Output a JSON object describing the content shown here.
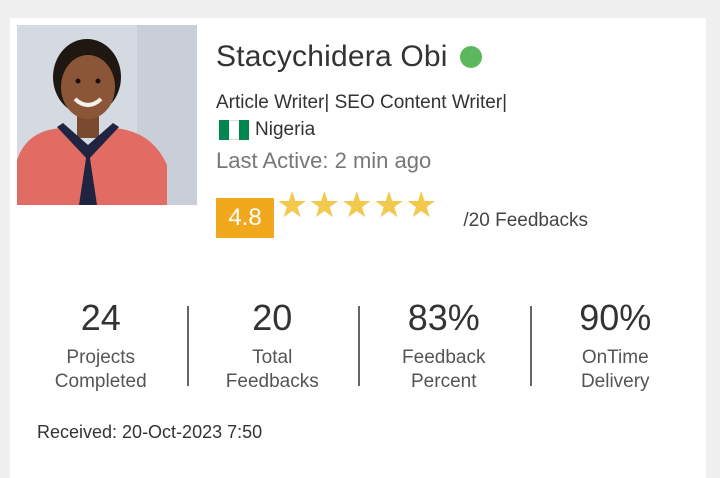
{
  "profile": {
    "name": "Stacychidera Obi",
    "online_status": "online",
    "role": "Article Writer| SEO Content Writer|",
    "country": "Nigeria",
    "country_flag": "nigeria-flag-icon",
    "last_active": "Last Active: 2 min ago",
    "rating": "4.8",
    "stars": 5,
    "feedback_count": "/20 Feedbacks"
  },
  "stats": [
    {
      "value": "24",
      "label_line1": "Projects",
      "label_line2": "Completed"
    },
    {
      "value": "20",
      "label_line1": "Total",
      "label_line2": "Feedbacks"
    },
    {
      "value": "83%",
      "label_line1": "Feedback",
      "label_line2": "Percent"
    },
    {
      "value": "90%",
      "label_line1": "OnTime",
      "label_line2": "Delivery"
    }
  ],
  "received": "Received: 20-Oct-2023 7:50",
  "colors": {
    "online": "#5cb85c",
    "rating_badge": "#f2a81d",
    "star": "#f2c94c",
    "flag_green": "#008751"
  }
}
